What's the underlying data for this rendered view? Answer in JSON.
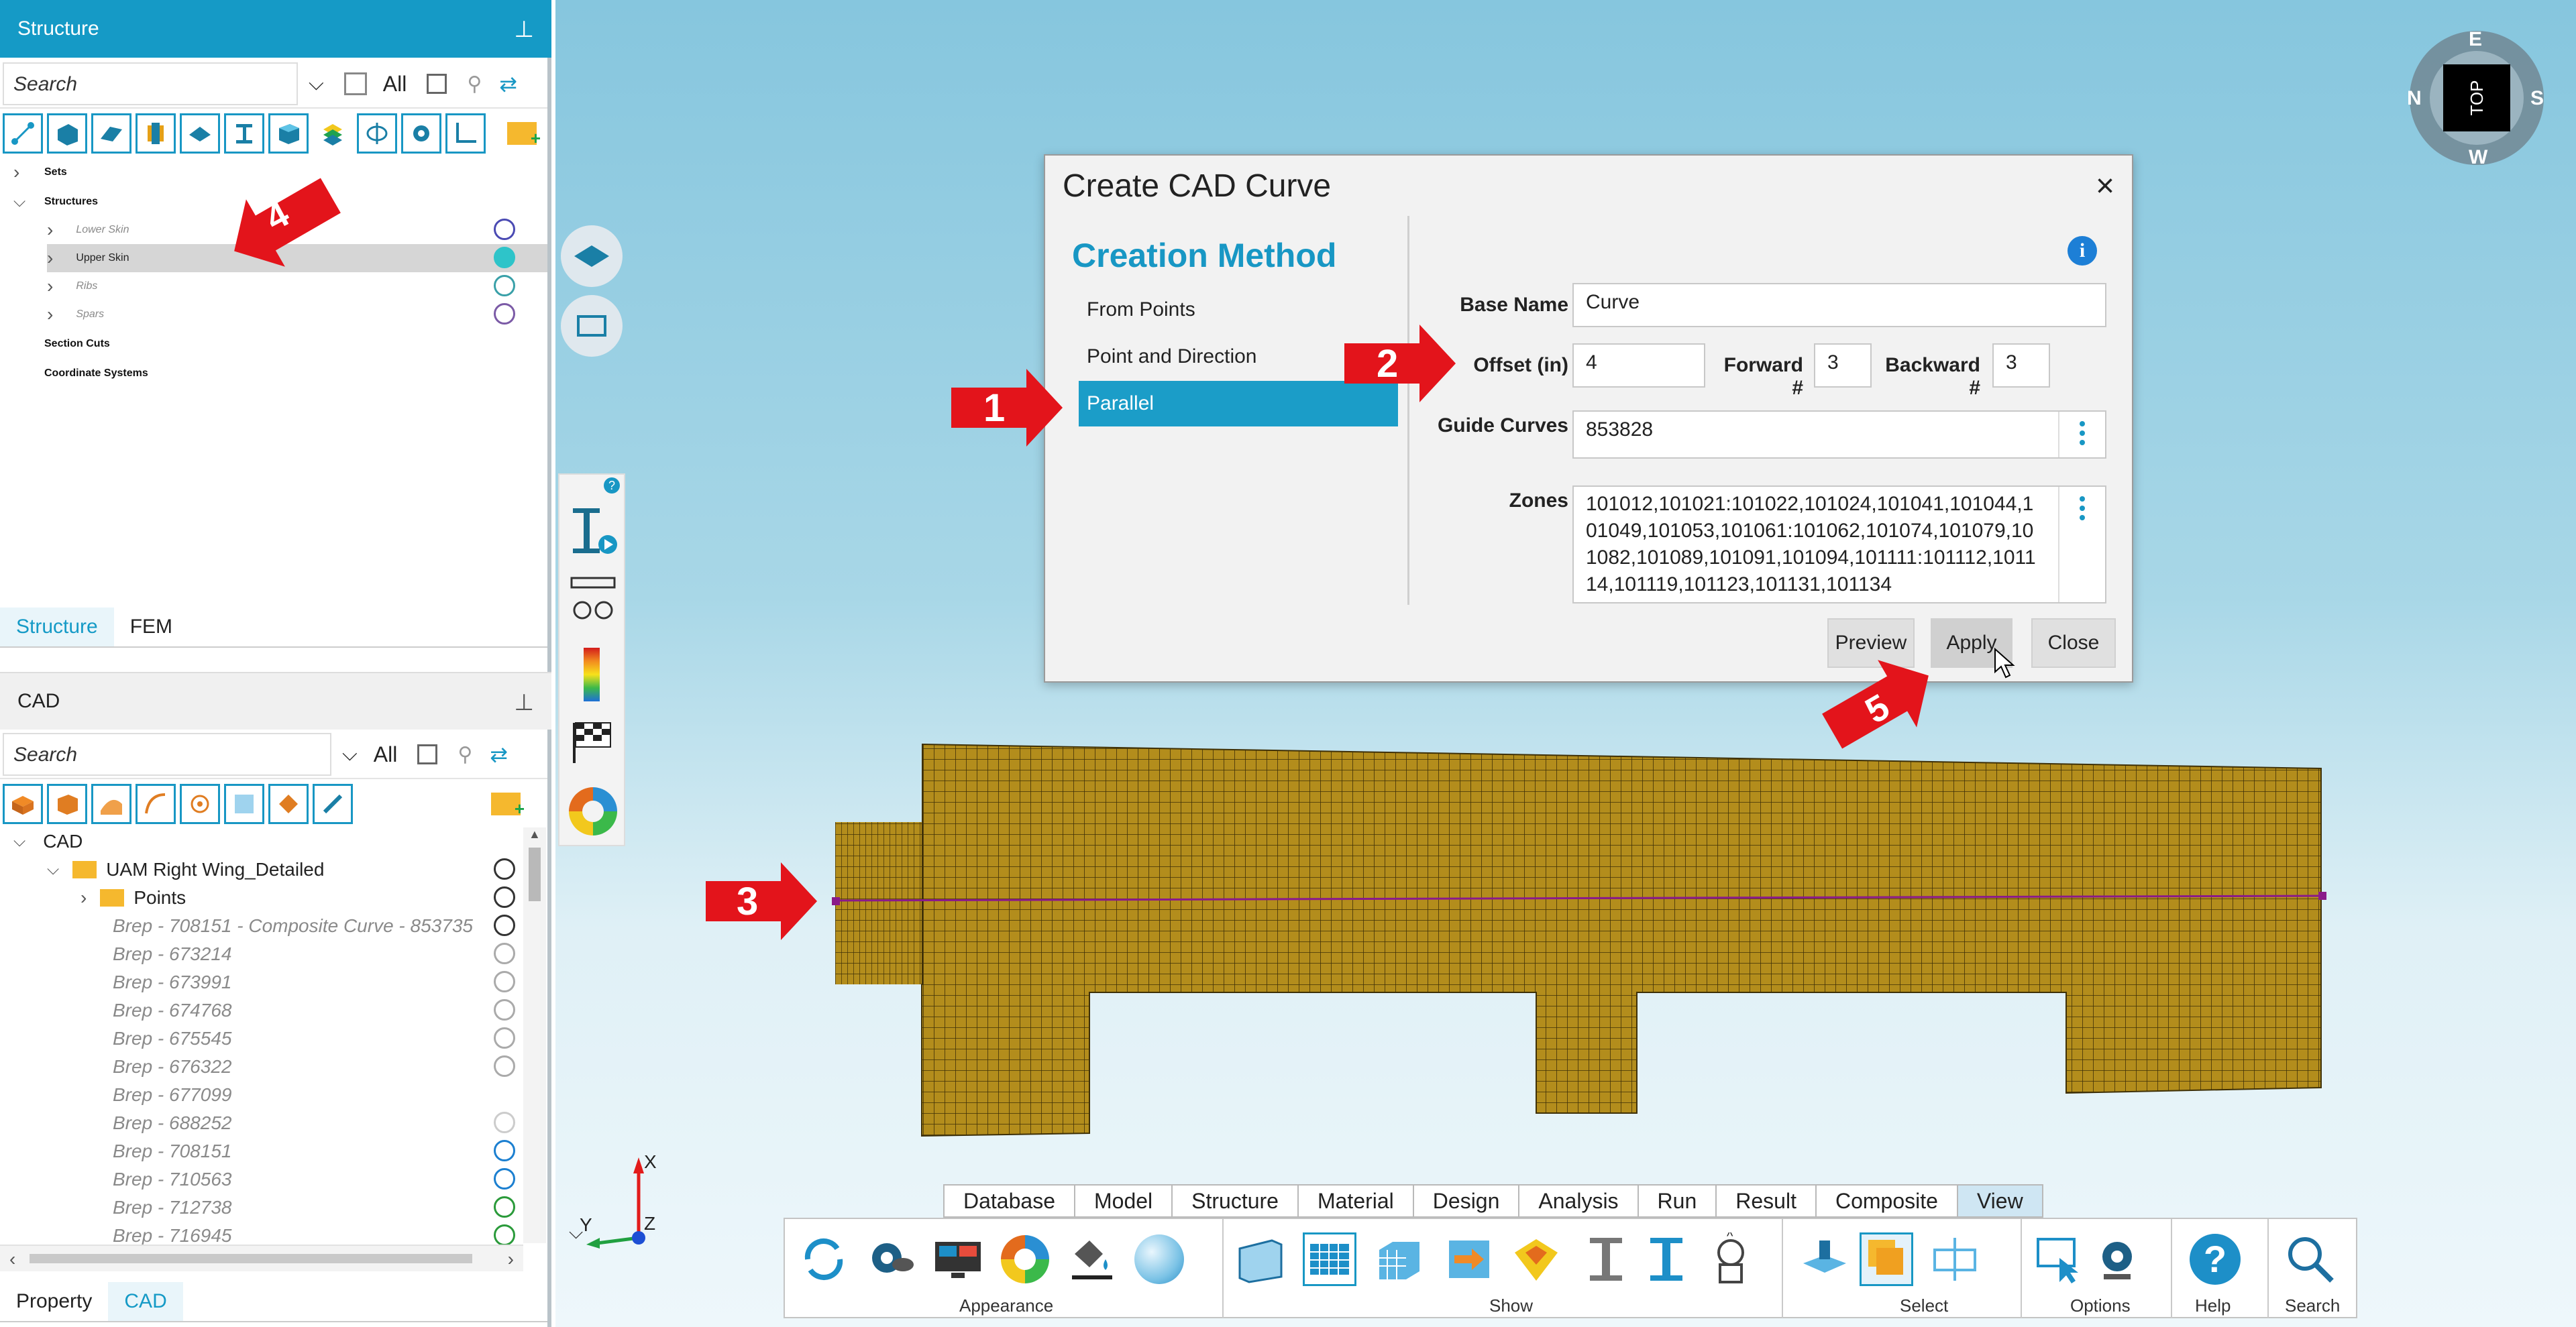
{
  "structure_panel": {
    "title": "Structure",
    "search_placeholder": "Search",
    "filter_label": "All",
    "tree": [
      {
        "label": "Sets",
        "style": "bold"
      },
      {
        "label": "Structures",
        "style": "bold"
      },
      {
        "label": "Lower Skin",
        "style": "italic"
      },
      {
        "label": "Upper Skin",
        "style": "selected"
      },
      {
        "label": "Ribs",
        "style": "italic"
      },
      {
        "label": "Spars",
        "style": "italic"
      },
      {
        "label": "Section Cuts",
        "style": "bold"
      },
      {
        "label": "Coordinate Systems",
        "style": "bold"
      }
    ],
    "tabs": [
      "Structure",
      "FEM"
    ]
  },
  "cad_panel": {
    "title": "CAD",
    "search_placeholder": "Search",
    "filter_label": "All",
    "tree": [
      {
        "label": "CAD"
      },
      {
        "label": "UAM Right Wing_Detailed"
      },
      {
        "label": "Points"
      },
      {
        "label": "Brep - 708151 - Composite Curve - 853735"
      },
      {
        "label": "Brep - 673214"
      },
      {
        "label": "Brep - 673991"
      },
      {
        "label": "Brep - 674768"
      },
      {
        "label": "Brep - 675545"
      },
      {
        "label": "Brep - 676322"
      },
      {
        "label": "Brep - 677099"
      },
      {
        "label": "Brep - 688252"
      },
      {
        "label": "Brep - 708151"
      },
      {
        "label": "Brep - 710563"
      },
      {
        "label": "Brep - 712738"
      },
      {
        "label": "Brep - 716945"
      }
    ],
    "tabs": [
      "Property",
      "CAD"
    ]
  },
  "dialog": {
    "title": "Create CAD Curve",
    "close": "×",
    "section": "Creation Method",
    "methods": [
      "From Points",
      "Point and Direction",
      "Parallel"
    ],
    "selected_method": "Parallel",
    "base_name_label": "Base Name",
    "base_name_value": "Curve",
    "offset_label": "Offset (in)",
    "offset_value": "4",
    "forward_label": "Forward #",
    "forward_value": "3",
    "backward_label": "Backward #",
    "backward_value": "3",
    "guide_label": "Guide Curves",
    "guide_value": "853828",
    "zones_label": "Zones",
    "zones_value": "101012,101021:101022,101024,101041,101044,101049,101053,101061:101062,101074,101079,101082,101089,101091,101094,101111:101112,101114,101119,101123,101131,101134",
    "buttons": [
      "Preview",
      "Apply",
      "Close"
    ]
  },
  "callouts": [
    "1",
    "2",
    "3",
    "4",
    "5"
  ],
  "compass": {
    "center": "TOP",
    "labels": [
      "E",
      "S",
      "W",
      "N"
    ]
  },
  "axes": {
    "x": "X",
    "y": "Y",
    "z": "Z"
  },
  "menu_tabs": [
    "Database",
    "Model",
    "Structure",
    "Material",
    "Design",
    "Analysis",
    "Run",
    "Result",
    "Composite",
    "View"
  ],
  "active_menu_tab": "View",
  "ribbon_groups": [
    "Appearance",
    "Show",
    "Select",
    "Options",
    "Help",
    "Search"
  ],
  "colors": {
    "accent": "#1897c4",
    "callout": "#e3141b",
    "mesh": "#b38d1c"
  }
}
